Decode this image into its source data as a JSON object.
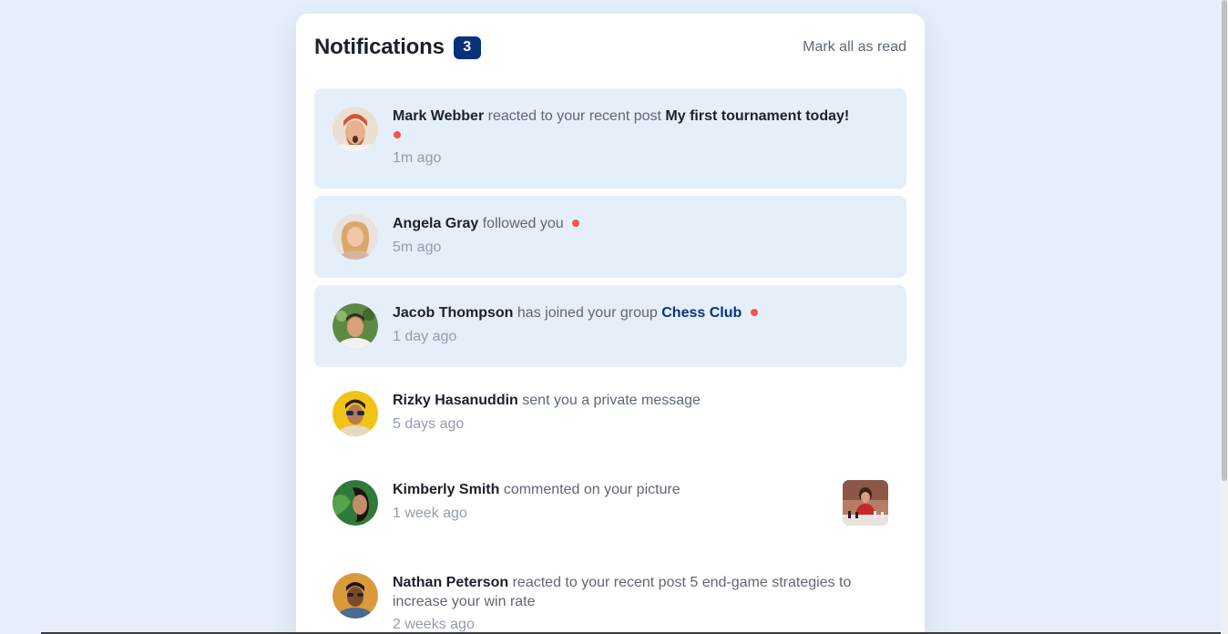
{
  "header": {
    "title": "Notifications",
    "unread_count": "3",
    "mark_all_label": "Mark all as read"
  },
  "notifications": [
    {
      "name": "Mark Webber",
      "action": "reacted to your recent post",
      "target": "My first tournament today!",
      "time": "1m ago",
      "unread": true,
      "avatar_icon": "avatar-mark-webber"
    },
    {
      "name": "Angela Gray",
      "action": "followed you",
      "time": "5m ago",
      "unread": true,
      "avatar_icon": "avatar-angela-gray"
    },
    {
      "name": "Jacob Thompson",
      "action": "has joined your group",
      "target": "Chess Club",
      "time": "1 day ago",
      "unread": true,
      "avatar_icon": "avatar-jacob-thompson"
    },
    {
      "name": "Rizky Hasanuddin",
      "action": "sent you a private message",
      "time": "5 days ago",
      "unread": false,
      "avatar_icon": "avatar-rizky-hasanuddin"
    },
    {
      "name": "Kimberly Smith",
      "action": "commented on your picture",
      "time": "1 week ago",
      "unread": false,
      "avatar_icon": "avatar-kimberly-smith",
      "picture_icon": "chess-picture-thumbnail"
    },
    {
      "name": "Nathan Peterson",
      "action": "reacted to your recent post 5 end-game strategies to increase your win rate",
      "time": "2 weeks ago",
      "unread": false,
      "avatar_icon": "avatar-nathan-peterson"
    }
  ],
  "colors": {
    "page_bg": "#e5eefa",
    "unread_bg": "#e5effa",
    "badge_bg": "#0a327b",
    "dot": "#f65552",
    "text_dark": "#1c202b",
    "text_muted": "#5e6778",
    "text_time": "#939cad"
  }
}
